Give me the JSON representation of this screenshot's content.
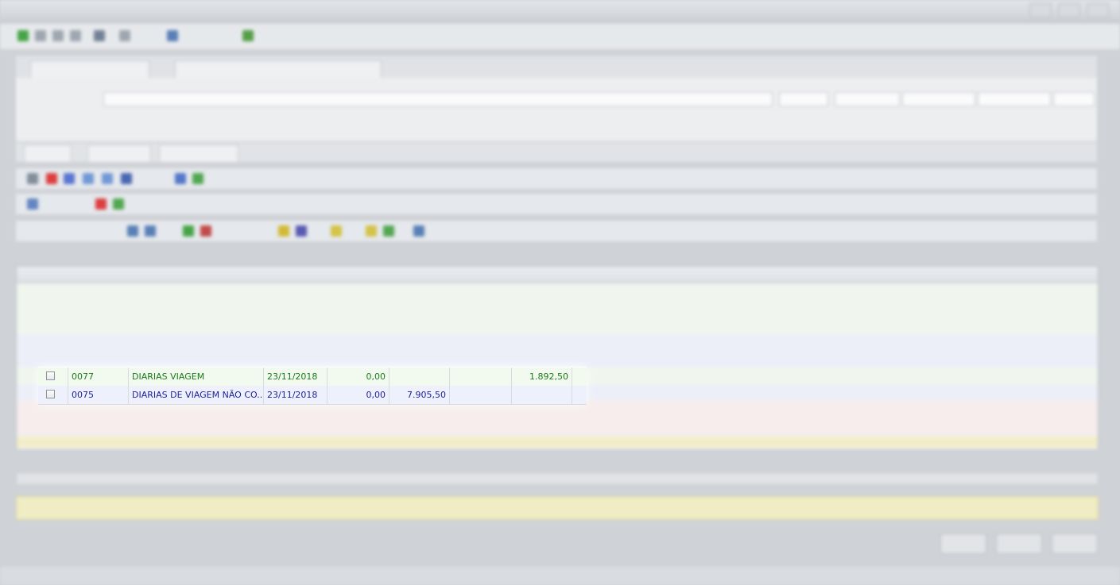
{
  "rows": [
    {
      "code": "0077",
      "description": "DIARIAS VIAGEM",
      "date": "23/11/2018",
      "val1": "0,00",
      "val2": "",
      "val3": "",
      "val4": "1.892,50",
      "color": "#1b7a1b"
    },
    {
      "code": "0075",
      "description": "DIARIAS DE VIAGEM NÃO CO...",
      "date": "23/11/2018",
      "val1": "0,00",
      "val2": "7.905,50",
      "val3": "",
      "val4": "",
      "color": "#1a1f9f"
    }
  ],
  "colors": {
    "green_row": "#1b7a1b",
    "blue_row": "#1a1f9f",
    "red_row": "#d52a2a",
    "summary_bg": "#f3efc2"
  },
  "icons": {
    "checkbox": "checkbox-icon"
  }
}
